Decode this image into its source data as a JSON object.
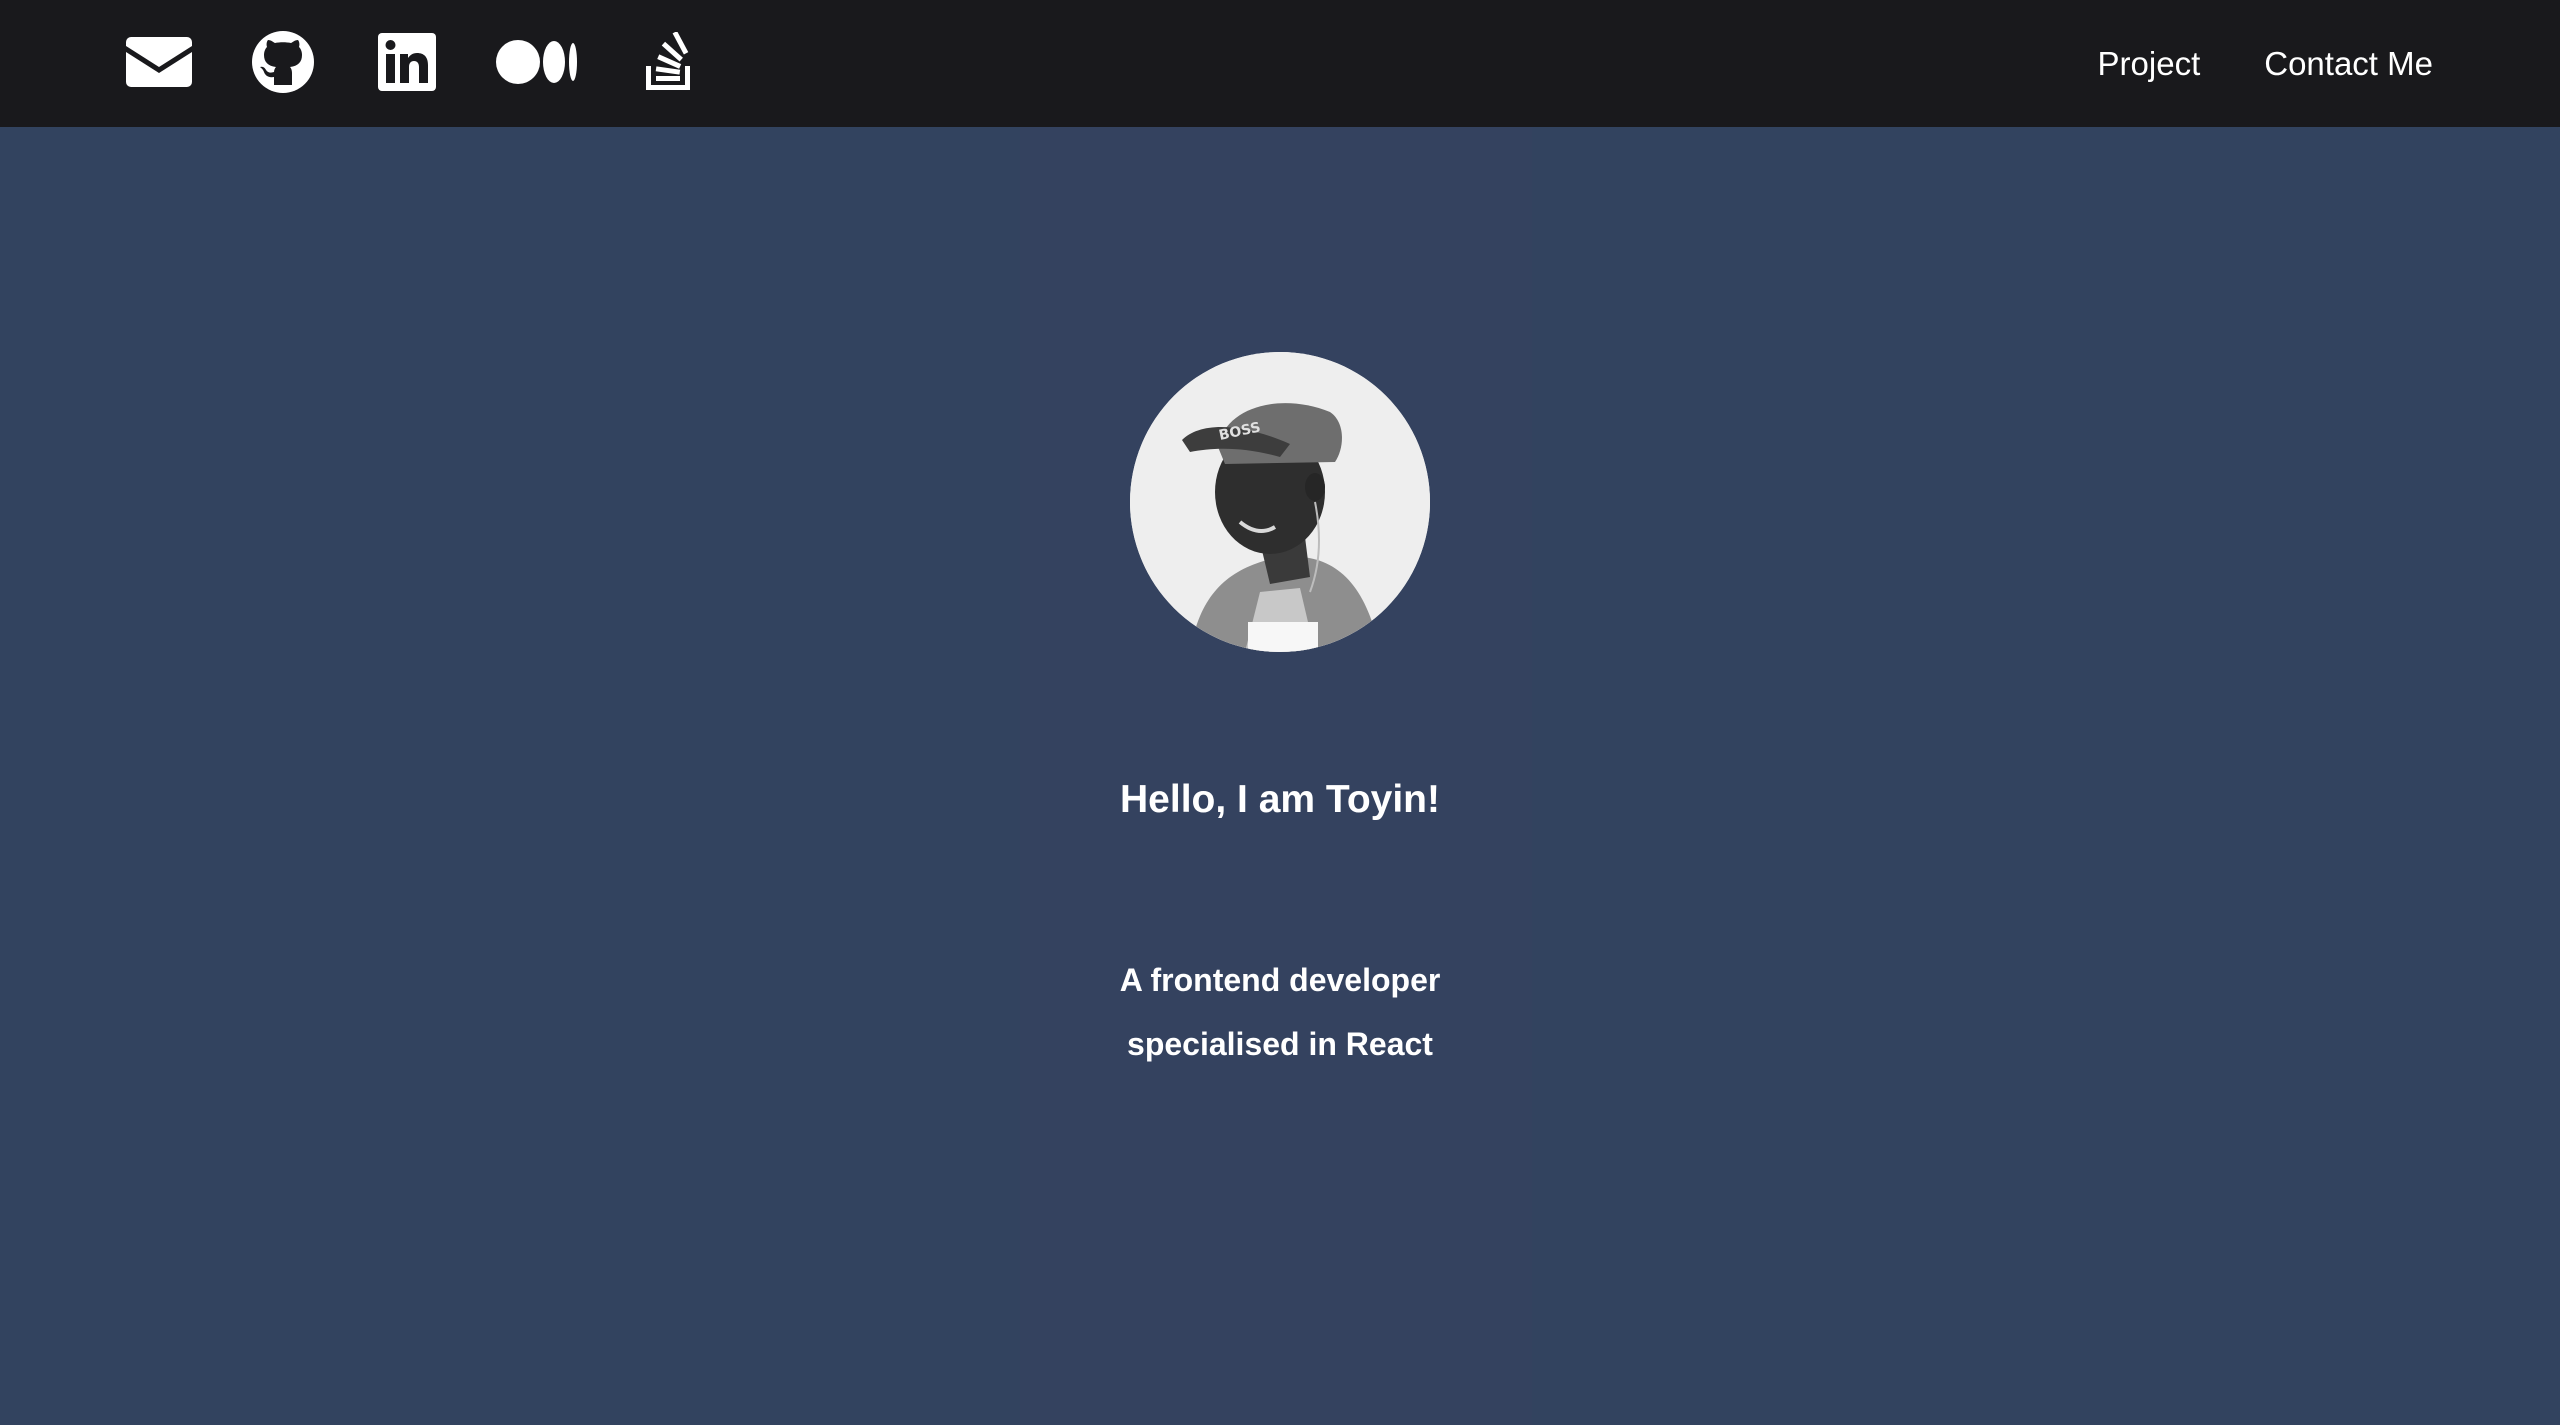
{
  "header": {
    "social_icons": [
      "mail-icon",
      "github-icon",
      "linkedin-icon",
      "medium-icon",
      "stackoverflow-icon"
    ],
    "nav": {
      "project": "Project",
      "contact": "Contact Me"
    }
  },
  "hero": {
    "greeting": "Hello, I am Toyin!",
    "tagline_line1": "A frontend developer",
    "tagline_line2": "specialised in React"
  },
  "colors": {
    "header_bg": "#19191c",
    "page_bg": "#32435f",
    "text": "#ffffff"
  }
}
